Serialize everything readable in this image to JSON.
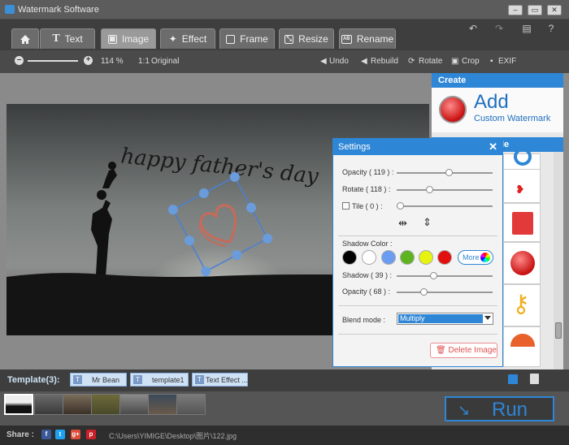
{
  "window": {
    "title": "Watermark Software"
  },
  "tabs": [
    {
      "label": "",
      "icon": "home-icon"
    },
    {
      "label": "Text",
      "icon": "text-icon"
    },
    {
      "label": "Image",
      "icon": "image-icon",
      "active": true
    },
    {
      "label": "Effect",
      "icon": "effect-icon"
    },
    {
      "label": "Frame",
      "icon": "frame-icon"
    },
    {
      "label": "Resize",
      "icon": "resize-icon"
    },
    {
      "label": "Rename",
      "icon": "rename-icon"
    }
  ],
  "toolbar": {
    "zoom": "114 %",
    "original": "Original",
    "undo": "Undo",
    "rebuild": "Rebuild",
    "rotate": "Rotate",
    "crop": "Crop",
    "exif": "EXIF"
  },
  "create_panel": {
    "header": "Create",
    "add_title": "Add",
    "add_subtitle": "Custom Watermark",
    "style_header_tail": "le"
  },
  "settings": {
    "title": "Settings",
    "opacity_label": "Opacity ( 119 ) :",
    "opacity_level": 0.55,
    "rotate_label": "Rotate ( 118 ) :",
    "rotate_level": 0.33,
    "tile_label": "Tile ( 0 ) :",
    "tile_level": 0.0,
    "shadow_color_label": "Shadow Color :",
    "shadow_colors": [
      "#000000",
      "#ffffff",
      "#6a9cf2",
      "#5db320",
      "#e6f20f",
      "#e30e0e"
    ],
    "more_label": "More",
    "shadow_label": "Shadow ( 39 ) :",
    "shadow_level": 0.38,
    "shadow_opacity_label": "Opacity ( 68 ) :",
    "shadow_opacity_level": 0.27,
    "blend_label": "Blend mode :",
    "blend_value": "Multiply",
    "delete_label": "Delete Image"
  },
  "watermark_text": "happy father's day",
  "templates": {
    "label": "Template(3):",
    "items": [
      "Mr Bean",
      "template1",
      "Text Effect ..."
    ]
  },
  "run_label": "Run",
  "status": {
    "share_label": "Share :",
    "file_path": "C:\\Users\\YIMIGE\\Desktop\\图片\\122.jpg"
  }
}
